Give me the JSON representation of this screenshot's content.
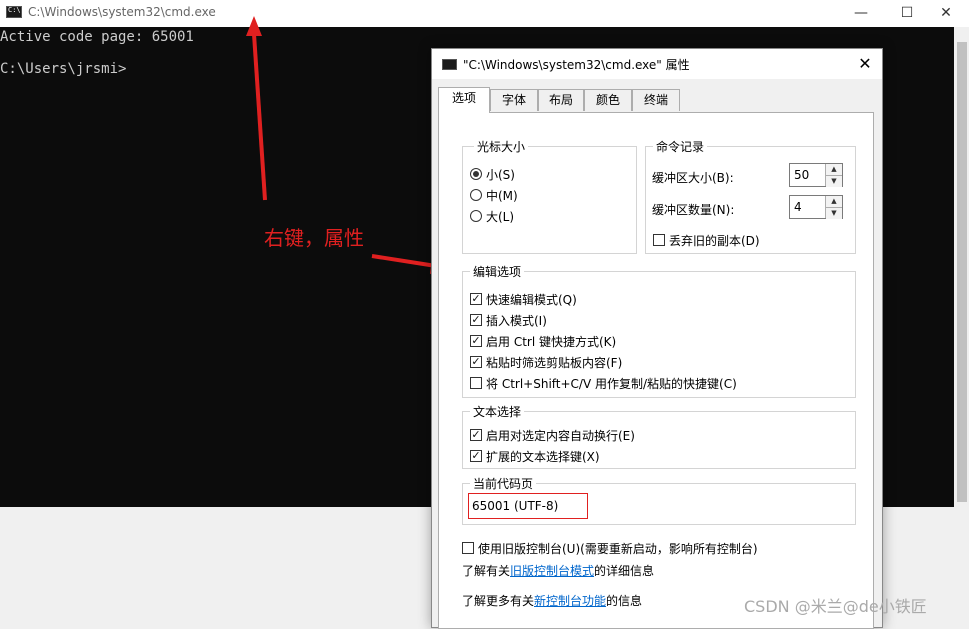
{
  "cmd_window": {
    "icon_glyph": "C:\\",
    "title": "C:\\Windows\\system32\\cmd.exe",
    "minimize": "—",
    "maximize": "☐",
    "close": "✕",
    "lines": [
      "Active code page: 65001",
      "",
      "C:\\Users\\jrsmi>"
    ]
  },
  "dialog": {
    "title": "\"C:\\Windows\\system32\\cmd.exe\" 属性",
    "close": "✕",
    "tabs": [
      {
        "label": "选项",
        "active": true
      },
      {
        "label": "字体",
        "active": false
      },
      {
        "label": "布局",
        "active": false
      },
      {
        "label": "颜色",
        "active": false
      },
      {
        "label": "终端",
        "active": false
      }
    ],
    "cursor_size": {
      "label": "光标大小",
      "options": [
        {
          "label": "小(S)",
          "selected": true
        },
        {
          "label": "中(M)",
          "selected": false
        },
        {
          "label": "大(L)",
          "selected": false
        }
      ]
    },
    "command_history": {
      "label": "命令记录",
      "buffer_size_label": "缓冲区大小(B):",
      "buffer_size_value": "50",
      "buffer_count_label": "缓冲区数量(N):",
      "buffer_count_value": "4",
      "discard_label": "丢弃旧的副本(D)",
      "discard_checked": false
    },
    "edit_options": {
      "label": "编辑选项",
      "items": [
        {
          "label": "快速编辑模式(Q)",
          "checked": true
        },
        {
          "label": "插入模式(I)",
          "checked": true
        },
        {
          "label": "启用 Ctrl 键快捷方式(K)",
          "checked": true
        },
        {
          "label": "粘贴时筛选剪贴板内容(F)",
          "checked": true
        },
        {
          "label": "将 Ctrl+Shift+C/V 用作复制/粘贴的快捷键(C)",
          "checked": false
        }
      ]
    },
    "text_selection": {
      "label": "文本选择",
      "items": [
        {
          "label": "启用对选定内容自动换行(E)",
          "checked": true
        },
        {
          "label": "扩展的文本选择键(X)",
          "checked": true
        }
      ]
    },
    "code_page": {
      "label": "当前代码页",
      "value": "65001 (UTF-8)",
      "highlight_color": "#e02020"
    },
    "legacy_console": {
      "label": "使用旧版控制台(U)(需要重新启动，影响所有控制台)",
      "checked": false
    },
    "info_line1": {
      "prefix": "了解有关",
      "link": "旧版控制台模式",
      "suffix": "的详细信息"
    },
    "info_line2": {
      "prefix": "了解更多有关",
      "link": "新控制台功能",
      "suffix": "的信息"
    }
  },
  "annotation": {
    "text": "右键，属性",
    "color": "#e02020"
  },
  "watermark": "CSDN @米兰@de小铁匠",
  "icons": {
    "check": "✓",
    "spin_up": "▲",
    "spin_down": "▼"
  }
}
